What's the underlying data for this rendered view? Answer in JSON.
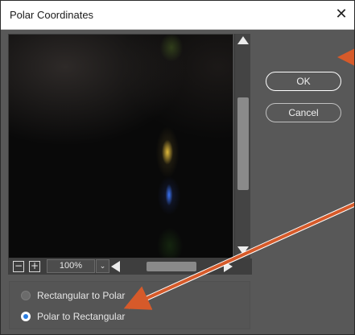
{
  "dialog": {
    "title": "Polar Coordinates",
    "close_glyph": "✕"
  },
  "preview": {
    "zoom_minus": "−",
    "zoom_plus": "+",
    "zoom_value": "100%",
    "zoom_dropdown_glyph": "⌄"
  },
  "options": {
    "items": [
      {
        "label": "Rectangular to Polar",
        "selected": false
      },
      {
        "label": "Polar to Rectangular",
        "selected": true
      }
    ]
  },
  "buttons": {
    "ok_label": "OK",
    "cancel_label": "Cancel"
  },
  "annotations": {
    "arrow_color": "#d65a2a",
    "icons": [
      "arrow-to-ok-icon",
      "arrow-to-polar-to-rectangular-icon"
    ]
  },
  "colors": {
    "dialog_bg": "#585858",
    "accent": "#2a7de1"
  }
}
